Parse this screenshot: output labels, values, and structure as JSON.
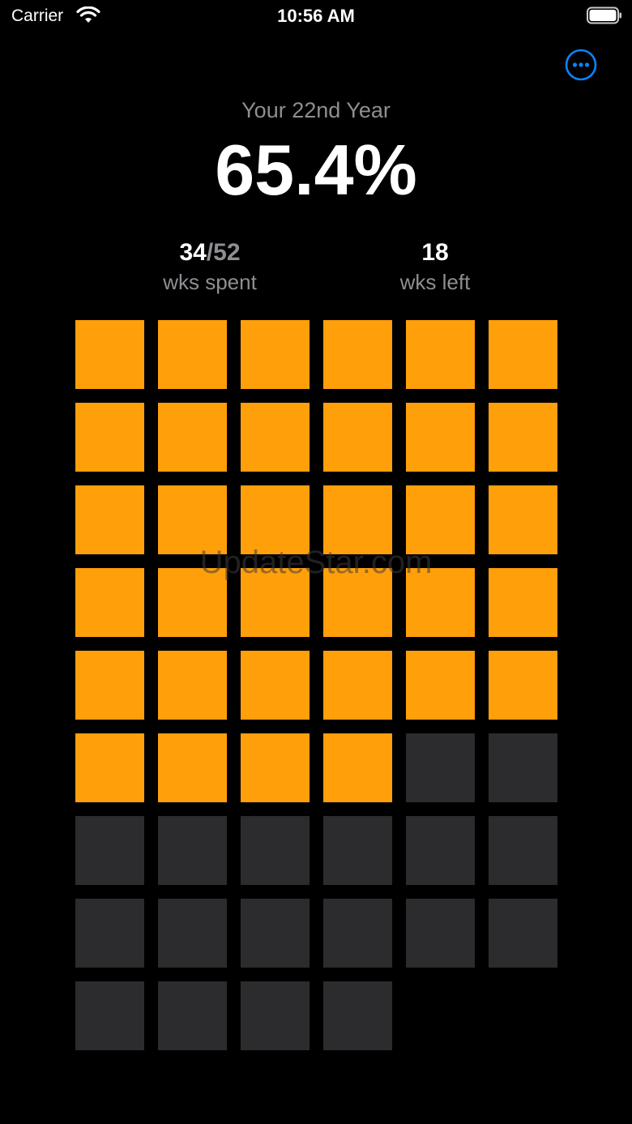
{
  "status_bar": {
    "carrier": "Carrier",
    "time": "10:56 AM",
    "wifi_icon": "wifi-icon",
    "battery_icon": "battery-full-icon"
  },
  "toolbar": {
    "more_icon": "ellipsis-circle-icon",
    "accent_color": "#0a84ff"
  },
  "header": {
    "year_label": "Your 22nd Year",
    "percent": "65.4%"
  },
  "stats": {
    "spent_value": "34",
    "spent_separator": "/",
    "spent_total": "52",
    "spent_caption": "wks spent",
    "left_value": "18",
    "left_caption": "wks left"
  },
  "weeks_grid": {
    "total": 52,
    "spent": 34,
    "columns": 6,
    "spent_color": "#ff9f0a",
    "remaining_color": "#2c2c2e"
  },
  "watermark": {
    "text": "UpdateStar.com"
  }
}
